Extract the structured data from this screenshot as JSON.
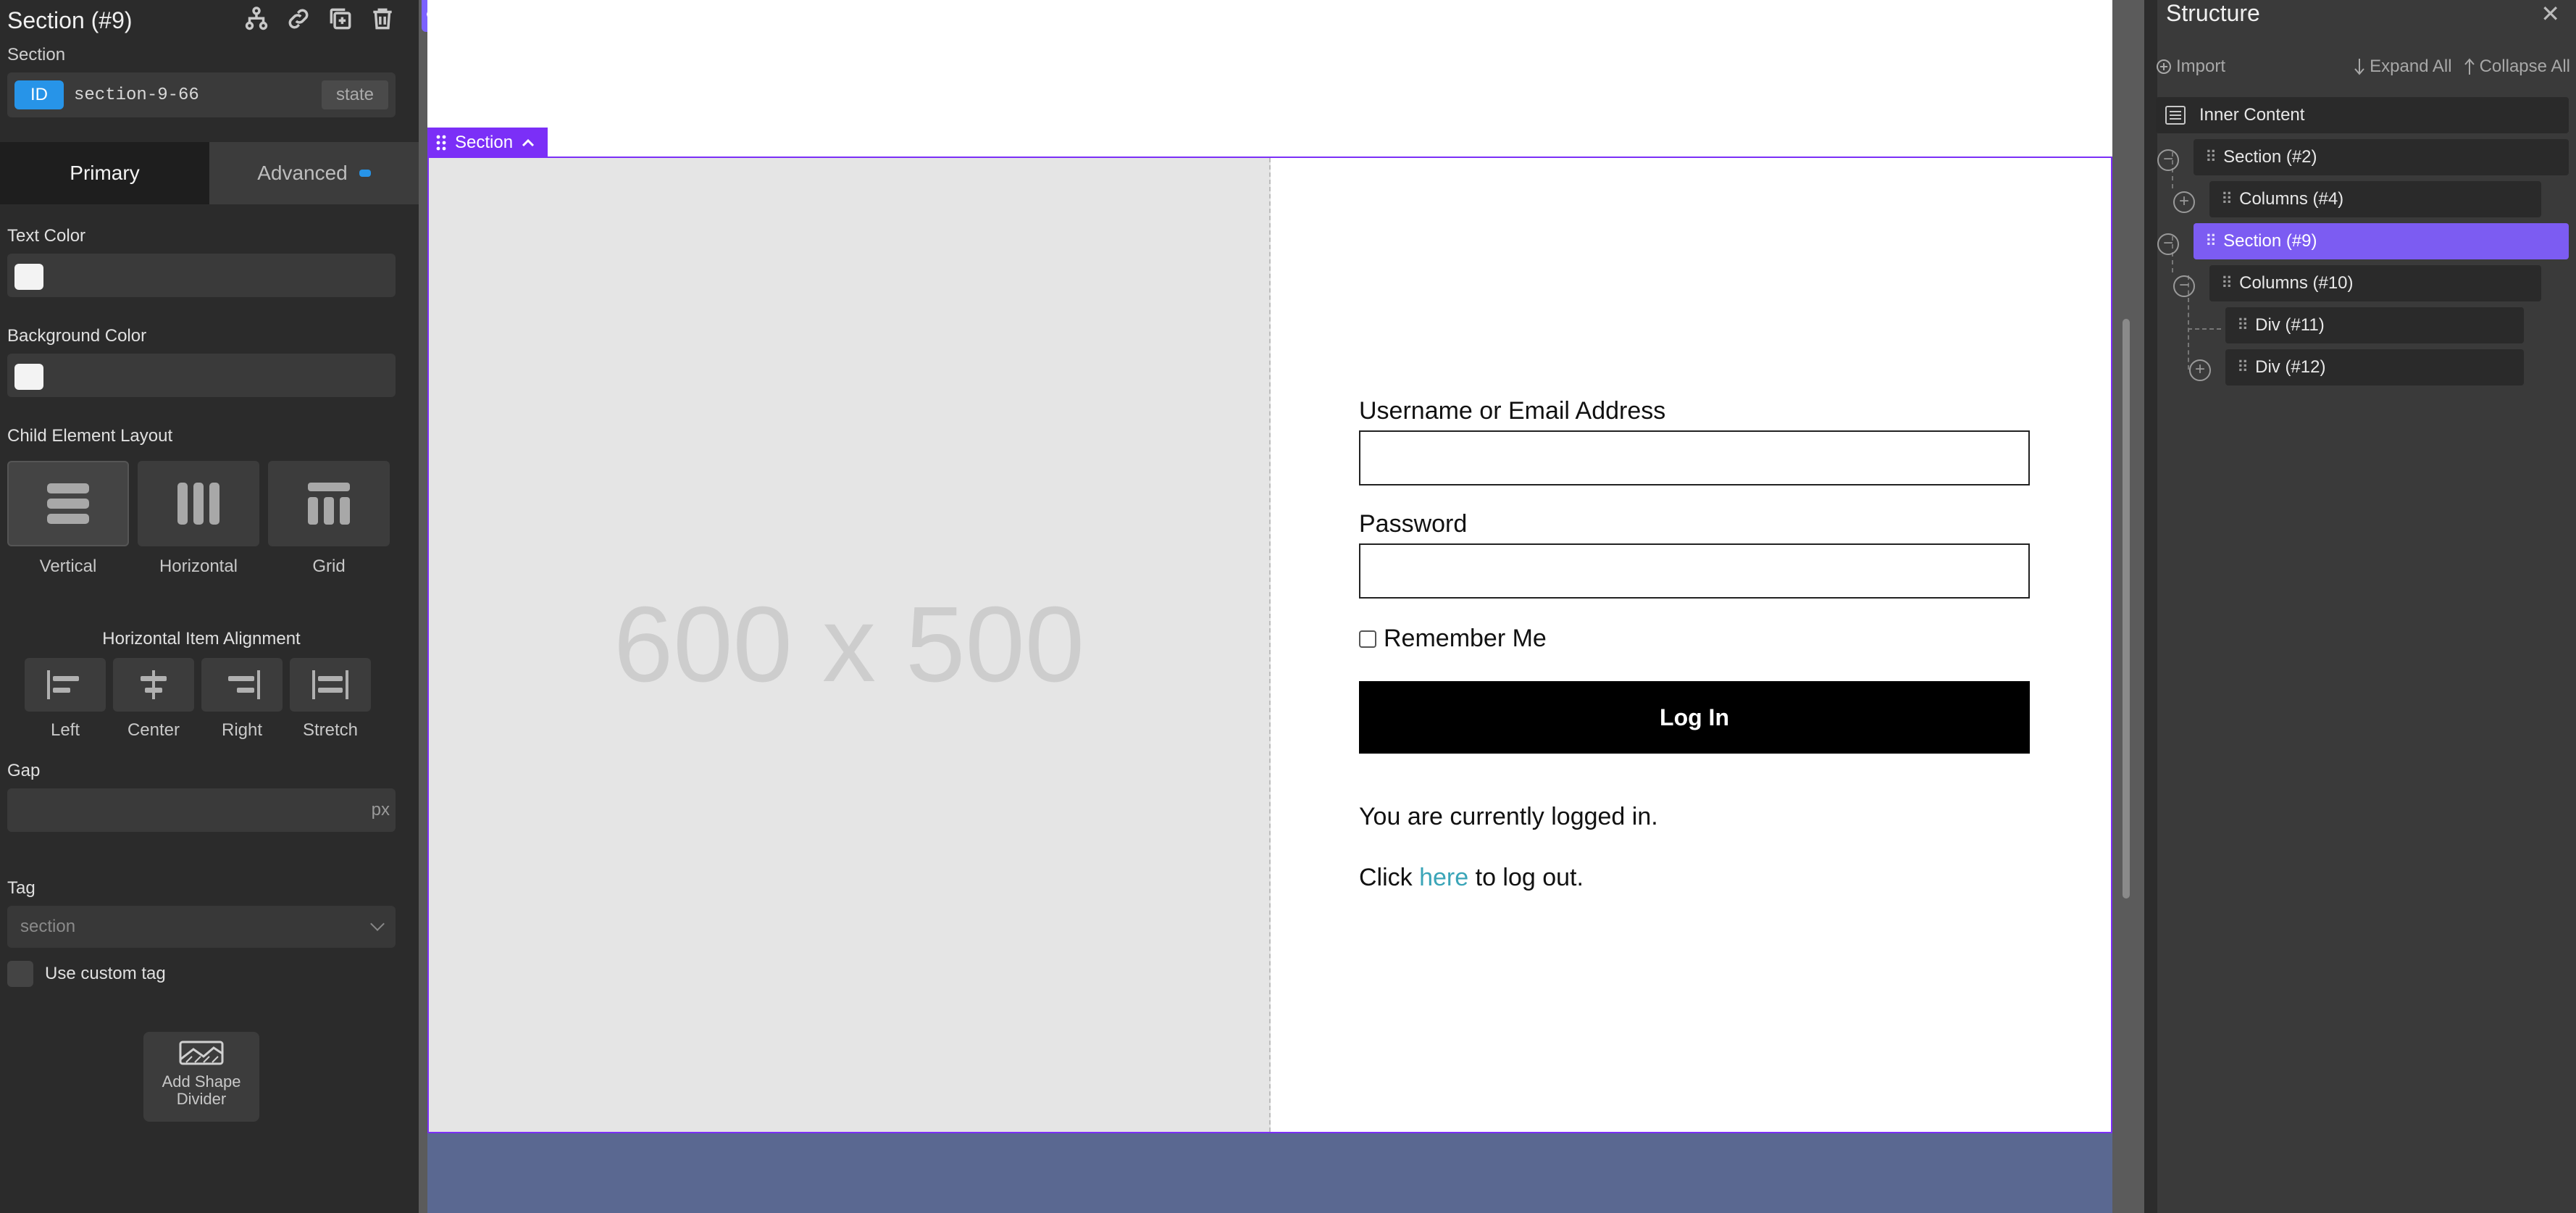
{
  "left_panel": {
    "title": "Section (#9)",
    "subtitle": "Section",
    "id_badge": "ID",
    "id_value": "section-9-66",
    "state_label": "state",
    "tabs": {
      "primary": "Primary",
      "advanced": "Advanced"
    },
    "text_color_label": "Text Color",
    "background_color_label": "Background Color",
    "child_layout_label": "Child Element Layout",
    "layout_options": [
      "Vertical",
      "Horizontal",
      "Grid"
    ],
    "horizontal_alignment_label": "Horizontal Item Alignment",
    "alignment_options": [
      "Left",
      "Center",
      "Right",
      "Stretch"
    ],
    "gap_label": "Gap",
    "gap_unit": "px",
    "tag_label": "Tag",
    "tag_value": "section",
    "custom_tag_label": "Use custom tag",
    "shape_divider_line1": "Add Shape",
    "shape_divider_line2": "Divider"
  },
  "canvas": {
    "collapse_handle": "⟨",
    "section_label": "Section",
    "placeholder_text": "600 x 500",
    "login": {
      "username_label": "Username or Email Address",
      "password_label": "Password",
      "remember_label": "Remember Me",
      "login_button": "Log In",
      "logged_in_msg": "You are currently logged in.",
      "logout_prefix": "Click ",
      "logout_link": "here",
      "logout_suffix": " to log out."
    }
  },
  "right_panel": {
    "title": "Structure",
    "close": "✕",
    "import_label": "Import",
    "expand_all_label": "Expand All",
    "collapse_all_label": "Collapse All",
    "tree": [
      {
        "label": "Inner Content",
        "selected": false
      },
      {
        "label": "Section (#2)",
        "selected": false
      },
      {
        "label": "Columns (#4)",
        "selected": false
      },
      {
        "label": "Section (#9)",
        "selected": true
      },
      {
        "label": "Columns (#10)",
        "selected": false
      },
      {
        "label": "Div (#11)",
        "selected": false
      },
      {
        "label": "Div (#12)",
        "selected": false
      }
    ]
  },
  "colors": {
    "accent": "#7b2ff7",
    "selected_node": "#7c5cf2",
    "id_badge": "#2794e8",
    "link": "#3aa5b8"
  }
}
